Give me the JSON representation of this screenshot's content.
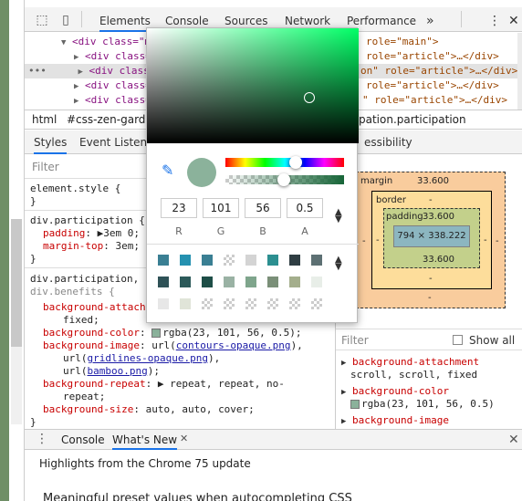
{
  "toolbar": {
    "tabs": [
      "Elements",
      "Console",
      "Sources",
      "Network",
      "Performance"
    ],
    "more": "»",
    "kebab": "⋮",
    "close": "✕"
  },
  "dom": {
    "lines": [
      {
        "a": "<div class=\"m",
        "b": "role=\"main\">"
      },
      {
        "a": "<div class=",
        "b": "role=\"article\">…</div>"
      },
      {
        "a": "<div class=",
        "b": "on\" role=\"article\">…</div>"
      },
      {
        "a": "<div class=",
        "b": "role=\"article\">…</div>"
      },
      {
        "a": "<div class=",
        "b": "\" role=\"article\">…</div>"
      }
    ],
    "dots": "•••"
  },
  "breadcrumbs": [
    "html",
    "#css-zen-garden",
    "pation.participation"
  ],
  "subtabs": [
    "Styles",
    "Event Listener",
    "essibility"
  ],
  "styles": {
    "filter_placeholder": "Filter",
    "element_style": "element.style {",
    "close_brace": "}",
    "rule1_selector": "div.participation {",
    "rule1_prop1": "padding",
    "rule1_val1": "3em 0;",
    "rule1_prop2": "margin-top",
    "rule1_val2": "3em;",
    "rule2_selector1": "div.participation,",
    "rule2_selector2": "div.benefits {",
    "bg_attach": "background-attach",
    "bg_attach_val": "fixed;",
    "bg_color": "background-color",
    "bg_color_val": "rgba(23, 101, 56, 0.5);",
    "bg_image": "background-image",
    "bg_image_url": "url(",
    "bg_image_link1": "contours-opaque.png",
    "bg_image_close": "),",
    "bg_image_link2": "gridlines-opaque.png",
    "bg_image_link3": "bamboo.png",
    "bg_image_end": ");",
    "bg_repeat": "background-repeat",
    "bg_repeat_val": "repeat, repeat, no-",
    "bg_repeat_val2": "repeat;",
    "bg_size": "background-size",
    "bg_size_val": "auto, auto, cover;"
  },
  "picker": {
    "r": "23",
    "g": "101",
    "b": "56",
    "a": "0.5",
    "labels": [
      "R",
      "G",
      "B",
      "A"
    ],
    "palette_row1": [
      "#3a7f93",
      "#2591b0",
      "#3a7f93",
      "checker",
      "#d4d4d4",
      "#2c8f90",
      "#2f3e43",
      "#5d7073"
    ],
    "palette_row2": [
      "#2f5257",
      "#2c5a5a",
      "#1e4e47",
      "#9ab2a4",
      "#7fa58c",
      "#7a8f78",
      "#a4ae8c",
      "#e8eee8"
    ],
    "palette_row3": [
      "#e7e7e7",
      "#e0e4d8",
      "checker",
      "checker",
      "checker",
      "checker",
      "checker",
      "checker"
    ]
  },
  "boxmodel": {
    "margin_label": "margin",
    "margin_top": "33.600",
    "margin_bottom": "33.600",
    "border_label": "border",
    "border_val": "-",
    "padding_label": "padding",
    "padding_top": "33.600",
    "padding_bottom": "33.600",
    "content": "794 × 338.222",
    "dash": "-"
  },
  "computed": {
    "filter_placeholder": "Filter",
    "show_all": "Show all",
    "items": [
      {
        "prop": "background-attachment",
        "val": "scroll, scroll, fixed"
      },
      {
        "prop": "background-color",
        "val": "rgba(23, 101, 56, 0.5)"
      },
      {
        "prop": "background-image",
        "val": ""
      }
    ]
  },
  "drawer": {
    "tabs": [
      "Console",
      "What's New"
    ],
    "headline": "Highlights from the Chrome 75 update",
    "item1": "Meaningful preset values when autocompleting CSS"
  }
}
